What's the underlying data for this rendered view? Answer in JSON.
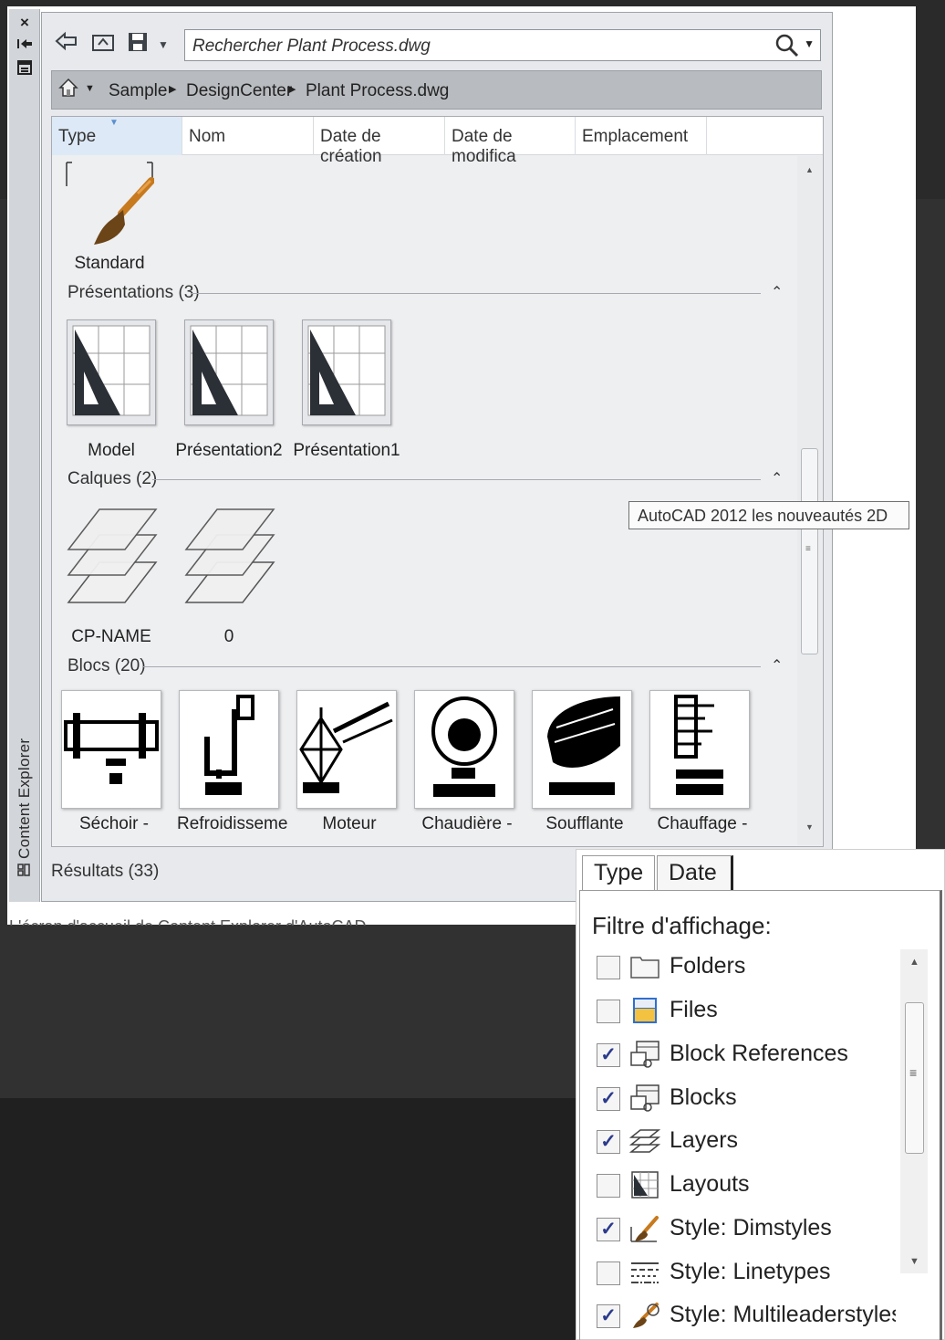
{
  "palette": {
    "title": "Content Explorer",
    "close_glyph": "×"
  },
  "toolbar": {
    "search_text": "Rechercher Plant Process.dwg"
  },
  "breadcrumb": {
    "items": [
      "Sample",
      "DesignCenter",
      "Plant Process.dwg"
    ]
  },
  "columns": [
    "Type",
    "Nom",
    "Date de création",
    "Date de modifica",
    "Emplacement"
  ],
  "sections": {
    "first_item": "Standard",
    "presentations": {
      "title": "Présentations (3)",
      "items": [
        "Model",
        "Présentation2",
        "Présentation1"
      ]
    },
    "calques": {
      "title": "Calques (2)",
      "items": [
        "CP-NAME",
        "0"
      ]
    },
    "blocs": {
      "title": "Blocs (20)",
      "items": [
        "Séchoir -",
        "Refroidisseme",
        "Moteur",
        "Chaudière -",
        "Soufflante",
        "Chauffage -"
      ]
    }
  },
  "status": "Résultats (33)",
  "tooltip": "AutoCAD 2012 les nouveautés 2D",
  "caption": "L'écran d'accueil de Content Explorer d'AutoCAD",
  "filter_popup": {
    "tabs": [
      "Type",
      "Date"
    ],
    "title": "Filtre d'affichage:",
    "items": [
      {
        "label": "Folders",
        "checked": false,
        "icon": "folder-icon"
      },
      {
        "label": "Files",
        "checked": false,
        "icon": "file-icon"
      },
      {
        "label": "Block References",
        "checked": true,
        "icon": "block-reference-icon"
      },
      {
        "label": "Blocks",
        "checked": true,
        "icon": "block-icon"
      },
      {
        "label": "Layers",
        "checked": true,
        "icon": "layers-icon"
      },
      {
        "label": "Layouts",
        "checked": false,
        "icon": "layout-icon"
      },
      {
        "label": "Style: Dimstyles",
        "checked": true,
        "icon": "dimstyle-icon"
      },
      {
        "label": "Style: Linetypes",
        "checked": false,
        "icon": "linetype-icon"
      },
      {
        "label": "Style: Multileaderstyles",
        "checked": true,
        "icon": "multileader-icon"
      }
    ]
  },
  "colors": {
    "accent": "#2b3a8c",
    "column_active": "#dde9f6"
  }
}
